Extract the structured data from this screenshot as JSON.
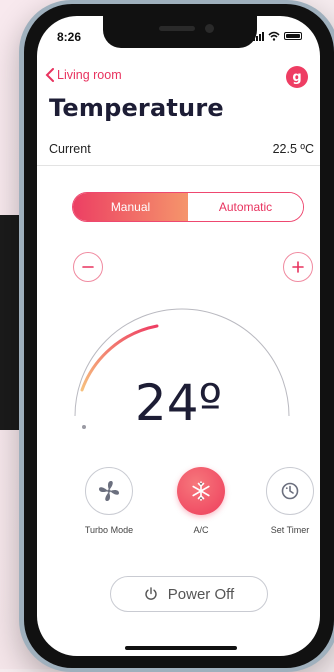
{
  "status": {
    "time": "8:26"
  },
  "nav": {
    "back_label": "Living room",
    "avatar_initial": "g"
  },
  "header": {
    "title": "Temperature"
  },
  "current": {
    "label": "Current",
    "value": "22.5 ºC"
  },
  "mode_toggle": {
    "options": [
      "Manual",
      "Automatic"
    ],
    "selected": "Manual"
  },
  "stepper": {
    "decrease_icon": "minus-icon",
    "increase_icon": "plus-icon"
  },
  "thermostat": {
    "setpoint_display": "24º",
    "setpoint": 24
  },
  "modes": [
    {
      "label": "Turbo Mode",
      "icon": "fan-icon",
      "active": false
    },
    {
      "label": "A/C",
      "icon": "snowflake-icon",
      "active": true
    },
    {
      "label": "Set Timer",
      "icon": "timer-icon",
      "active": false
    }
  ],
  "power": {
    "label": "Power Off",
    "icon": "power-icon"
  },
  "colors": {
    "accent": "#ee3d63",
    "accent_end": "#f5956b",
    "text_dark": "#1d1d35"
  }
}
